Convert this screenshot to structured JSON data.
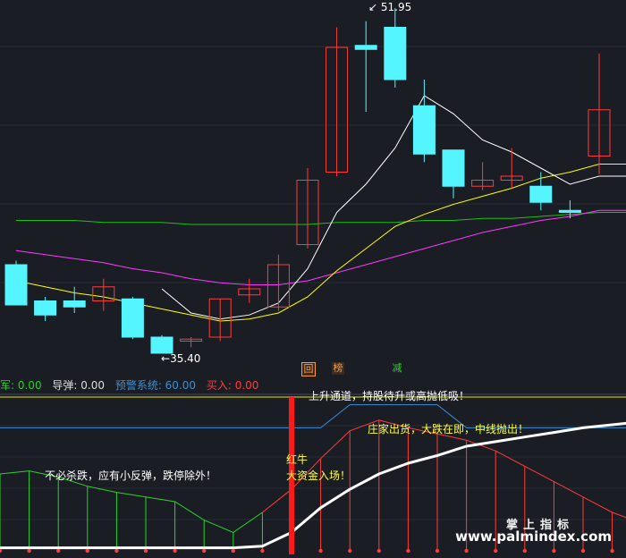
{
  "chart_data": {
    "type": "candlestick",
    "candles": [
      {
        "o": 39.2,
        "h": 39.4,
        "l": 37.5,
        "c": 37.2
      },
      {
        "o": 37.4,
        "h": 37.6,
        "l": 36.4,
        "c": 36.7
      },
      {
        "o": 37.4,
        "h": 38.1,
        "l": 36.8,
        "c": 37.1
      },
      {
        "o": 37.4,
        "h": 38.5,
        "l": 36.9,
        "c": 38.1
      },
      {
        "o": 37.5,
        "h": 37.6,
        "l": 35.5,
        "c": 35.6
      },
      {
        "o": 35.6,
        "h": 35.7,
        "l": 35.0,
        "c": 34.8
      },
      {
        "o": 35.4,
        "h": 35.6,
        "l": 35.1,
        "c": 35.5
      },
      {
        "o": 35.6,
        "h": 37.5,
        "l": 35.4,
        "c": 37.5
      },
      {
        "o": 37.7,
        "h": 38.5,
        "l": 37.3,
        "c": 38.0
      },
      {
        "o": 37.1,
        "h": 39.7,
        "l": 36.9,
        "c": 39.2
      },
      {
        "o": 40.2,
        "h": 44.0,
        "l": 40.0,
        "c": 43.4
      },
      {
        "o": 43.8,
        "h": 51.0,
        "l": 43.6,
        "c": 50.0
      },
      {
        "o": 50.1,
        "h": 51.3,
        "l": 46.8,
        "c": 49.9
      },
      {
        "o": 51.0,
        "h": 51.95,
        "l": 48.0,
        "c": 48.4
      },
      {
        "o": 47.1,
        "h": 48.4,
        "l": 44.3,
        "c": 44.7
      },
      {
        "o": 44.9,
        "h": 44.9,
        "l": 42.5,
        "c": 43.1
      },
      {
        "o": 43.1,
        "h": 44.3,
        "l": 42.9,
        "c": 43.4
      },
      {
        "o": 43.4,
        "h": 45.0,
        "l": 43.0,
        "c": 43.6
      },
      {
        "o": 43.1,
        "h": 43.8,
        "l": 41.9,
        "c": 42.3
      },
      {
        "o": 41.9,
        "h": 42.4,
        "l": 41.5,
        "c": 41.8
      },
      {
        "o": 44.6,
        "h": 49.7,
        "l": 43.7,
        "c": 46.9
      }
    ],
    "ma_white": [
      null,
      null,
      null,
      null,
      null,
      38.0,
      36.8,
      36.5,
      36.7,
      37.3,
      39.0,
      41.8,
      43.2,
      45.0,
      47.6,
      46.7,
      45.4,
      44.8,
      44.0,
      43.2,
      43.6
    ],
    "ma_yellow": [
      38.4,
      38.1,
      37.8,
      37.6,
      37.3,
      37.0,
      36.7,
      36.4,
      36.5,
      36.8,
      37.6,
      38.9,
      40.0,
      41.1,
      41.7,
      42.2,
      42.6,
      43.0,
      43.5,
      43.8,
      44.2
    ],
    "ma_magenta": [
      39.9,
      39.7,
      39.5,
      39.3,
      39.0,
      38.8,
      38.5,
      38.3,
      38.2,
      38.2,
      38.4,
      38.8,
      39.2,
      39.6,
      40.0,
      40.4,
      40.8,
      41.1,
      41.4,
      41.6,
      41.9
    ],
    "ma_green": [
      41.4,
      41.4,
      41.4,
      41.3,
      41.3,
      41.3,
      41.2,
      41.2,
      41.2,
      41.2,
      41.2,
      41.3,
      41.3,
      41.3,
      41.4,
      41.4,
      41.5,
      41.5,
      41.6,
      41.7,
      41.8
    ],
    "annotations": {
      "high_label": "51.95",
      "low_label": "35.40"
    },
    "badges": [
      "回",
      "榜",
      "减"
    ],
    "legend": [
      {
        "label": "军: ",
        "value": "0.00"
      },
      {
        "label": "导弹: ",
        "value": "0.00"
      },
      {
        "label": "预警系统: ",
        "value": "60.00"
      },
      {
        "label": "买入: ",
        "value": "0.00"
      }
    ],
    "indicator": {
      "range": [
        0,
        100
      ],
      "cyan_line": [
        80,
        80,
        80,
        80,
        80,
        80,
        80,
        80,
        80,
        80,
        80,
        80,
        95,
        95,
        95,
        95,
        80,
        80,
        80,
        80,
        80,
        80,
        80
      ],
      "yellow_line": [
        100,
        100,
        100,
        100,
        100,
        100,
        100,
        100,
        100,
        100,
        100,
        100,
        100,
        100,
        100,
        100,
        100,
        100,
        100,
        100,
        100,
        100,
        100
      ],
      "white_line": [
        2,
        2,
        2,
        2,
        2,
        2,
        2,
        2,
        2,
        3,
        12,
        28,
        40,
        50,
        57,
        62,
        68,
        71,
        74,
        77,
        80,
        82,
        84
      ],
      "stem_values": [
        50,
        52,
        48,
        42,
        38,
        35,
        32,
        20,
        12,
        25,
        40,
        60,
        78,
        85,
        80,
        76,
        72,
        65,
        55,
        45,
        35,
        25,
        18
      ],
      "signal_index": 10,
      "texts": [
        "上升通道，持股待升或高抛低吸！",
        "庄家出货，大跌在即，中线抛出！",
        "不必杀跌，应有小反弹，跌停除外！",
        "红牛",
        "大资金入场！"
      ]
    },
    "watermark": {
      "line1": "掌上指标",
      "line2": "www.palmindex.com"
    },
    "colors": {
      "up": "#ff3b3b",
      "down": "#55f5ff",
      "ma_white": "#ffffff",
      "ma_yellow": "#ffff00",
      "ma_magenta": "#ff38ff",
      "ma_green": "#19c219",
      "legend_green": "#26d426",
      "legend_grey": "#dddddd",
      "legend_blue": "#3a8fd8",
      "legend_red": "#ff3b3b",
      "badge_bg": "#3a2a20",
      "badge_fg": "#ff9a3a",
      "badge_green": "#30d030"
    }
  }
}
